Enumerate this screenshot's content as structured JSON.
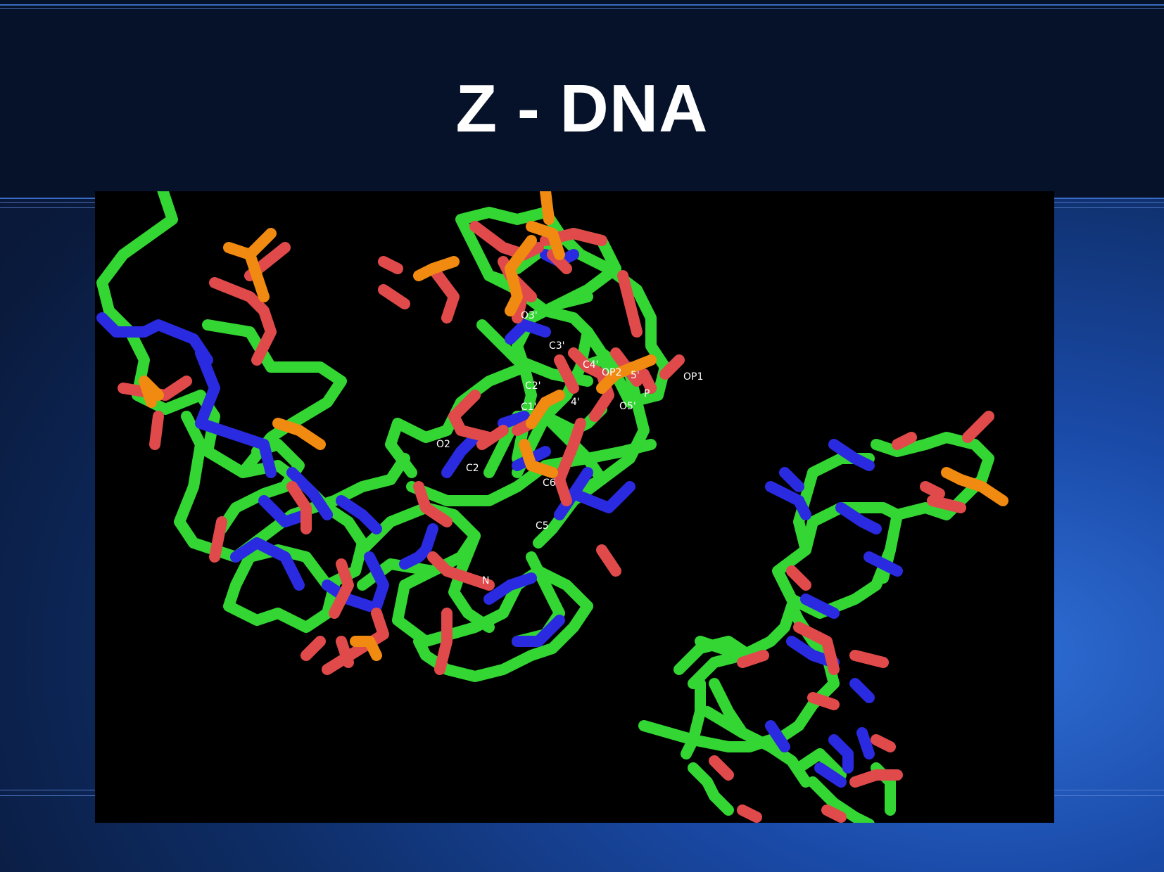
{
  "slide": {
    "title": "Z - DNA"
  },
  "molecule_image": {
    "icon": "molecular-structure-render",
    "colors": {
      "carbon": "#33d633",
      "nitrogen": "#2a2ae0",
      "oxygen": "#e04a4a",
      "phosphorus": "#f08a10",
      "background": "#000000"
    },
    "atom_labels": [
      "O3'",
      "C3'",
      "C4'",
      "OP2",
      "5'",
      "OP1",
      "C2'",
      "P",
      "C1'",
      "4'",
      "O5'",
      "O2",
      "C2",
      "C6",
      "C5",
      "N"
    ]
  }
}
